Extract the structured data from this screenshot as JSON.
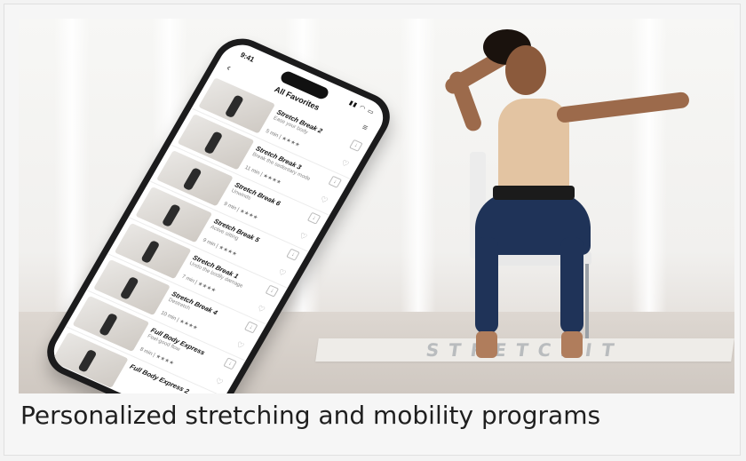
{
  "mat_brand": "STRETCHIT",
  "caption": "Personalized stretching and mobility programs",
  "phone": {
    "time": "9:41",
    "title": "All Favorites",
    "back_icon": "chevron-left-icon",
    "filter_icon": "sliders-icon",
    "items": [
      {
        "title": "Stretch Break 2",
        "subtitle": "Ease your body",
        "meta": "5 min | ★★★★"
      },
      {
        "title": "Stretch Break 3",
        "subtitle": "Break the sedentary mode",
        "meta": "11 min | ★★★★"
      },
      {
        "title": "Stretch Break 6",
        "subtitle": "Unwinds",
        "meta": "9 min | ★★★★"
      },
      {
        "title": "Stretch Break 5",
        "subtitle": "Active sitting",
        "meta": "9 min | ★★★★"
      },
      {
        "title": "Stretch Break 1",
        "subtitle": "Undo the bodily damage",
        "meta": "7 min | ★★★★"
      },
      {
        "title": "Stretch Break 4",
        "subtitle": "Destretch",
        "meta": "10 min | ★★★★"
      },
      {
        "title": "Full Body Express",
        "subtitle": "Feel-good flow",
        "meta": "8 min | ★★★★"
      },
      {
        "title": "Full Body Express 2",
        "subtitle": "",
        "meta": ""
      }
    ]
  }
}
